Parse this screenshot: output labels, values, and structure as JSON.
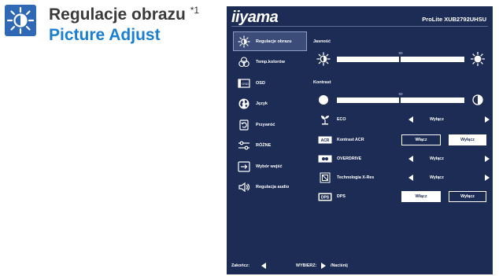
{
  "heading": {
    "title": "Regulacje obrazu",
    "note_mark": "*1",
    "subtitle": "Picture Adjust",
    "icon": "brightness-sun-icon"
  },
  "osd": {
    "brand": "iiyama",
    "model": "ProLite XUB2792UHSU",
    "menu": [
      {
        "label": "Regulacje obrazu",
        "icon": "brightness-sun-icon",
        "active": true
      },
      {
        "label": "Temp.kolorów",
        "icon": "color-circles-icon",
        "active": false
      },
      {
        "label": "OSD",
        "icon": "osd-icon",
        "active": false
      },
      {
        "label": "Język",
        "icon": "globe-icon",
        "active": false
      },
      {
        "label": "Przywróć",
        "icon": "reset-icon",
        "active": false
      },
      {
        "label": "RÓŻNE",
        "icon": "misc-sliders-icon",
        "active": false
      },
      {
        "label": "Wybór wejść",
        "icon": "input-select-icon",
        "active": false
      },
      {
        "label": "Regulacja audio",
        "icon": "speaker-icon",
        "active": false
      }
    ],
    "brightness": {
      "label": "Jasność",
      "value": "50",
      "level": 0.5
    },
    "contrast": {
      "label": "Kontrast",
      "value": "50",
      "level": 0.5
    },
    "rows": {
      "eco": {
        "label": "ECO",
        "value": "Wyłącz",
        "icon": "eco-plant-icon"
      },
      "acr": {
        "label": "Kontrast ACR",
        "on": "Włącz",
        "off": "Wyłącz",
        "selected": "off",
        "icon": "acr-icon"
      },
      "overdrive": {
        "label": "OVERDRIVE",
        "value": "Wyłącz",
        "icon": "overdrive-icon"
      },
      "xres": {
        "label": "Technologia X-Res",
        "value": "Wyłącz",
        "icon": "xres-icon"
      },
      "dps": {
        "label": "DPS",
        "on": "Włącz",
        "off": "Wyłącz",
        "selected": "off",
        "icon": "dps-icon"
      }
    },
    "footer": {
      "exit": "Zakończ:",
      "select": "WYBIERZ:",
      "press": "/Naciśnij"
    }
  }
}
